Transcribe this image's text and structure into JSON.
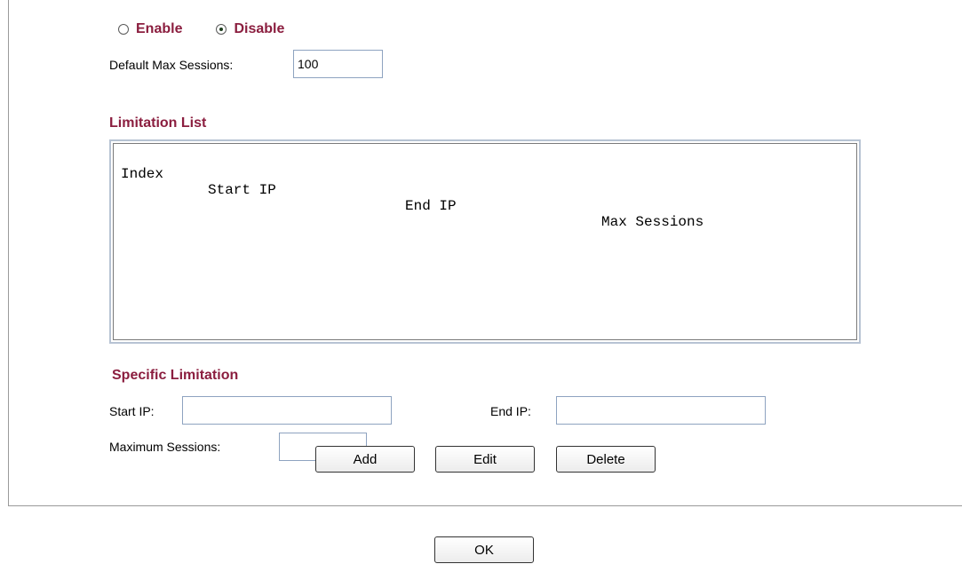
{
  "mode": {
    "options": [
      {
        "label": "Enable",
        "selected": false
      },
      {
        "label": "Disable",
        "selected": true
      }
    ]
  },
  "default_max_sessions": {
    "label": "Default Max Sessions:",
    "value": "100"
  },
  "limitation_list": {
    "title": "Limitation List",
    "columns": [
      "Index",
      "Start IP",
      "End IP",
      "Max Sessions"
    ],
    "rows": []
  },
  "specific_limitation": {
    "title": "Specific Limitation",
    "start_ip_label": "Start IP:",
    "start_ip_value": "",
    "end_ip_label": "End IP:",
    "end_ip_value": "",
    "max_sessions_label": "Maximum Sessions:",
    "max_sessions_value": ""
  },
  "buttons": {
    "add": "Add",
    "edit": "Edit",
    "delete": "Delete",
    "ok": "OK"
  },
  "colors": {
    "label_accent": "#8b1e3f",
    "input_border": "#8ea3c0"
  }
}
